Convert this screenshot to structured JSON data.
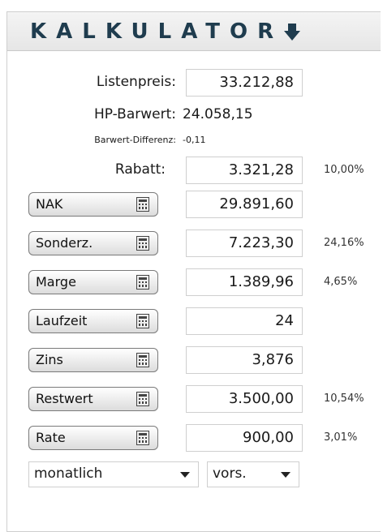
{
  "header": {
    "title": "KALKULATOR",
    "toggle_icon": "arrow-down-icon",
    "accent": "#1f3c4e"
  },
  "summary": {
    "listenpreis_label": "Listenpreis:",
    "listenpreis_value": "33.212,88",
    "barwert_label": "HP-Barwert:",
    "barwert_value": "24.058,15",
    "differenz_label": "Barwert-Differenz:",
    "differenz_value": "-0,11",
    "rabatt_label": "Rabatt:",
    "rabatt_value": "3.321,28",
    "rabatt_percent": "10,00%"
  },
  "calculators": [
    {
      "label": "NAK",
      "value": "29.891,60",
      "percent": ""
    },
    {
      "label": "Sonderz.",
      "value": "7.223,30",
      "percent": "24,16%"
    },
    {
      "label": "Marge",
      "value": "1.389,96",
      "percent": "4,65%"
    },
    {
      "label": "Laufzeit",
      "value": "24",
      "percent": ""
    },
    {
      "label": "Zins",
      "value": "3,876",
      "percent": ""
    },
    {
      "label": "Restwert",
      "value": "3.500,00",
      "percent": "10,54%"
    },
    {
      "label": "Rate",
      "value": "900,00",
      "percent": "3,01%"
    }
  ],
  "selects": {
    "interval": "monatlich",
    "timing": "vors."
  }
}
